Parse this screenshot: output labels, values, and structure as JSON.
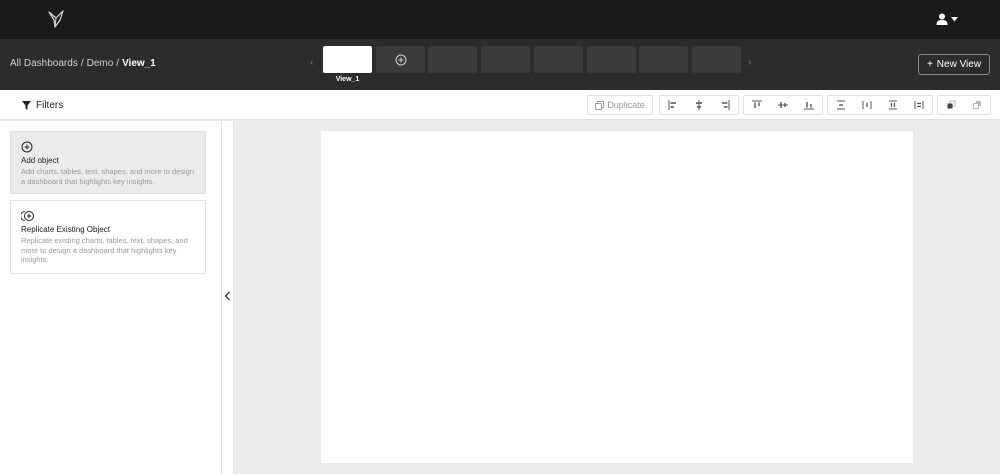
{
  "header": {
    "logo_icon": "bird-logo-icon",
    "user_icon": "user-icon"
  },
  "breadcrumb": {
    "all": "All Dashboards",
    "dashboard": "Demo",
    "current": "View_1",
    "separator": "/"
  },
  "views": {
    "prev_arrow": "‹",
    "next_arrow": "›",
    "active_label": "View_1",
    "add_icon": "plus-circle-icon"
  },
  "new_view_button": {
    "icon": "+",
    "label": "New View"
  },
  "toolbar": {
    "filters_label": "Filters",
    "duplicate_label": "Duplicate"
  },
  "panel": {
    "add_object": {
      "title": "Add object",
      "description": "Add charts, tables, text, shapes, and more to design a dashboard that highlights key insights."
    },
    "replicate_object": {
      "title": "Replicate Existing Object",
      "description": "Replicate existing charts, tables, text, shapes, and more to design a dashboard that highlights key insights."
    }
  },
  "colors": {
    "topbar": "#1a1a1a",
    "viewbar": "#2c2c2c",
    "workspace": "#ebebeb"
  }
}
